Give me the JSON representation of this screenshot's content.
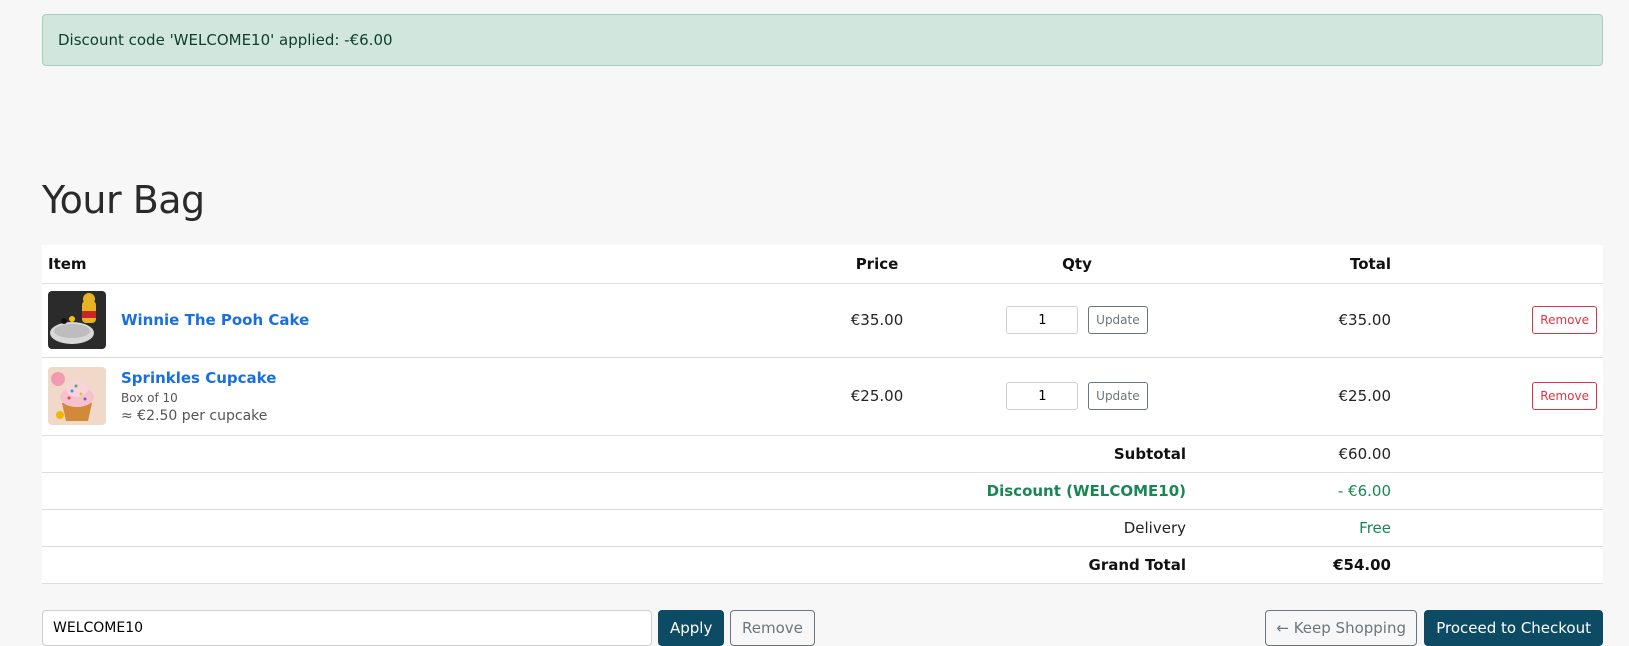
{
  "alert": {
    "message": "Discount code 'WELCOME10' applied: -€6.00"
  },
  "page": {
    "title": "Your Bag"
  },
  "table": {
    "headers": {
      "item": "Item",
      "price": "Price",
      "qty": "Qty",
      "total": "Total"
    },
    "rows": [
      {
        "name": "Winnie The Pooh Cake",
        "price": "€35.00",
        "qty": "1",
        "update_label": "Update",
        "total": "€35.00",
        "remove_label": "Remove"
      },
      {
        "name": "Sprinkles Cupcake",
        "variant": "Box of 10",
        "unit_price": "≈ €2.50 per cupcake",
        "price": "€25.00",
        "qty": "1",
        "update_label": "Update",
        "total": "€25.00",
        "remove_label": "Remove"
      }
    ]
  },
  "summary": {
    "subtotal_label": "Subtotal",
    "subtotal_value": "€60.00",
    "discount_label": "Discount (WELCOME10)",
    "discount_value": "- €6.00",
    "delivery_label": "Delivery",
    "delivery_value": "Free",
    "grand_total_label": "Grand Total",
    "grand_total_value": "€54.00"
  },
  "coupon": {
    "value": "WELCOME10",
    "apply_label": "Apply",
    "remove_label": "Remove"
  },
  "actions": {
    "keep_shopping_label": "← Keep Shopping",
    "checkout_label": "Proceed to Checkout"
  },
  "colors": {
    "alert_bg": "#d1e7dd",
    "link": "#1a6fe0",
    "primary": "#0d4a64",
    "danger": "#dc3545",
    "success": "#198754"
  }
}
